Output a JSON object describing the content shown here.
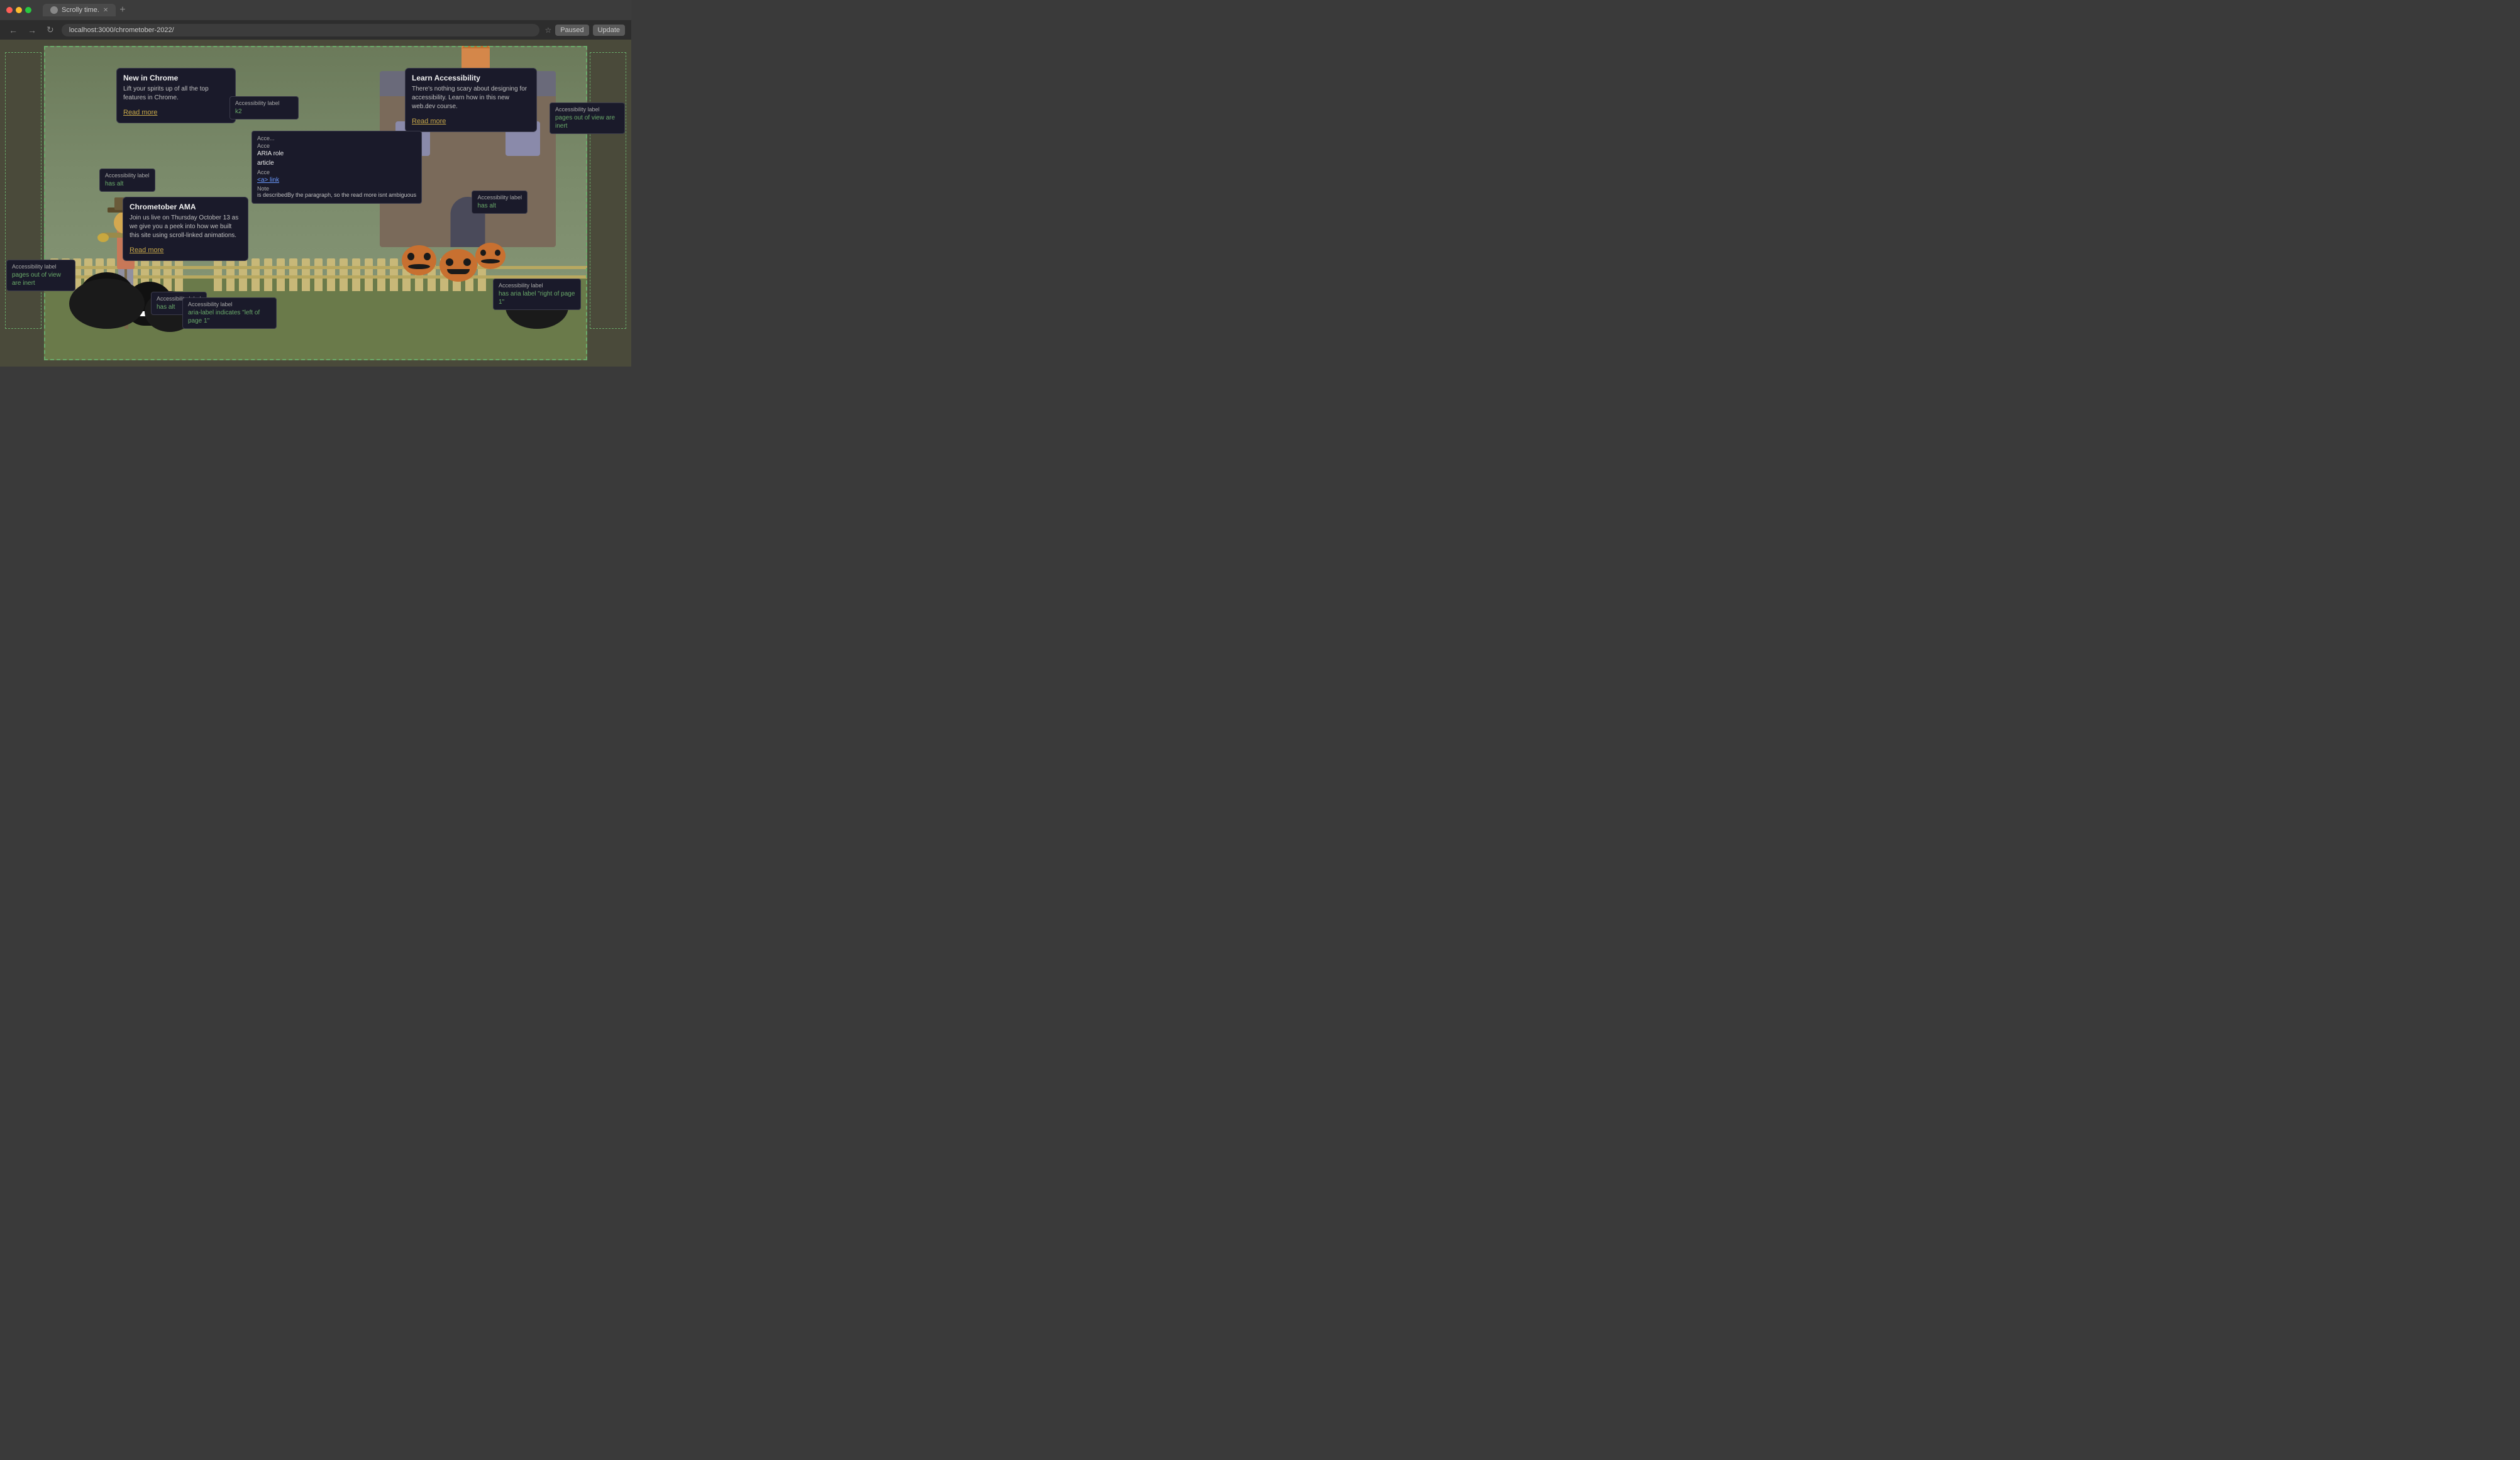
{
  "browser": {
    "tab_title": "Scrolly time.",
    "url": "localhost:3000/chrometober-2022/",
    "paused_label": "Paused",
    "update_label": "Update"
  },
  "cards": {
    "new_in_chrome": {
      "title": "New in Chrome",
      "body": "Lift your spirits up of all the top features in Chrome.",
      "read_more": "Read more"
    },
    "learn_accessibility": {
      "title": "Learn Accessibility",
      "body": "There's nothing scary about designing for accessibility. Learn how in this new web.dev course.",
      "read_more": "Read more"
    },
    "chrometober_ama": {
      "title": "Chrometober AMA",
      "body": "Join us live on Thursday October 13 as we give you a peek into how we built this site using scroll-linked animations.",
      "read_more": "Read more"
    }
  },
  "accessibility_labels": {
    "has_alt": "has alt",
    "pages_out_of_view_inert": "pages out of view are inert",
    "has_aria_label_right": "has aria label \"right of page 1\"",
    "aria_label_left": "aria-label indicates \"left of page 1\"",
    "top_right_inert": "pages out of view are inert"
  },
  "aria_popup": {
    "acc_label_title": "Acce...",
    "acc_label_value": "k2",
    "acce_row": "Acce",
    "aria_role_title": "ARIA role",
    "aria_role_value": "article",
    "acce_element_title": "Acce",
    "acce_element_value": "<a> link",
    "note_title": "Note",
    "note_text": "is describedBy the paragraph, so the read more isnt ambiguous"
  }
}
